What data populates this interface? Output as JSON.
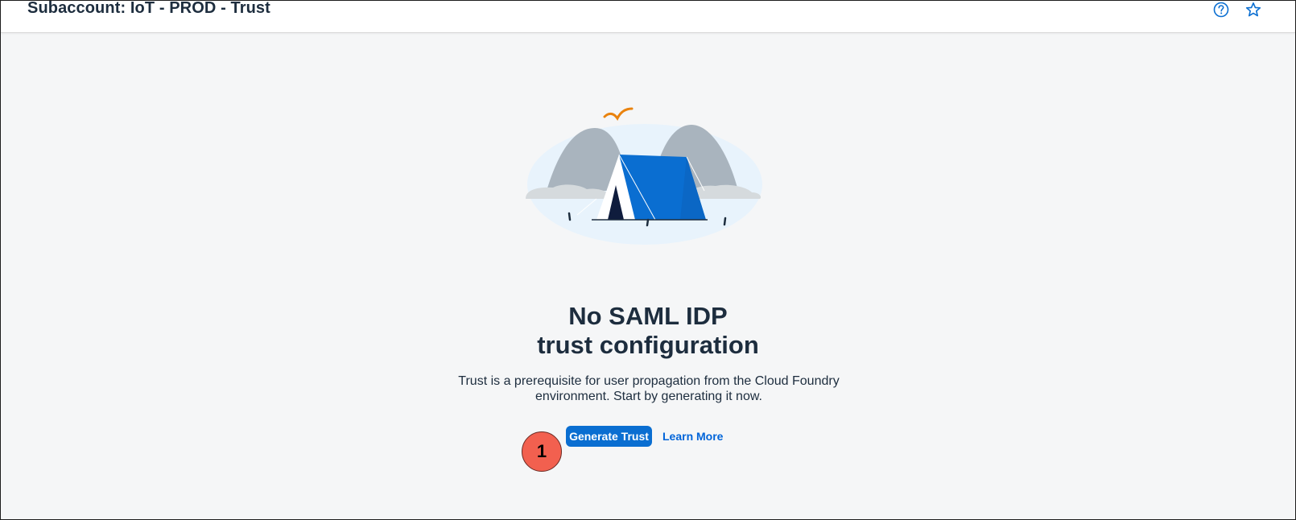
{
  "header": {
    "title": "Subaccount: IoT - PROD - Trust",
    "icons": [
      "help-icon",
      "star-icon"
    ]
  },
  "empty_state": {
    "illustration": "tent-icon",
    "title_line1": "No SAML IDP",
    "title_line2": "trust configuration",
    "description": "Trust is a prerequisite for user propagation from the Cloud Foundry environment. Start by generating it now.",
    "primary_button": "Generate Trust",
    "link": "Learn More"
  },
  "annotation": {
    "step_number": "1"
  },
  "colors": {
    "accent": "#0a6ed1",
    "link": "#0064d9",
    "text": "#1d2d3e",
    "background": "#f5f6f7",
    "badge": "#f2604f"
  }
}
